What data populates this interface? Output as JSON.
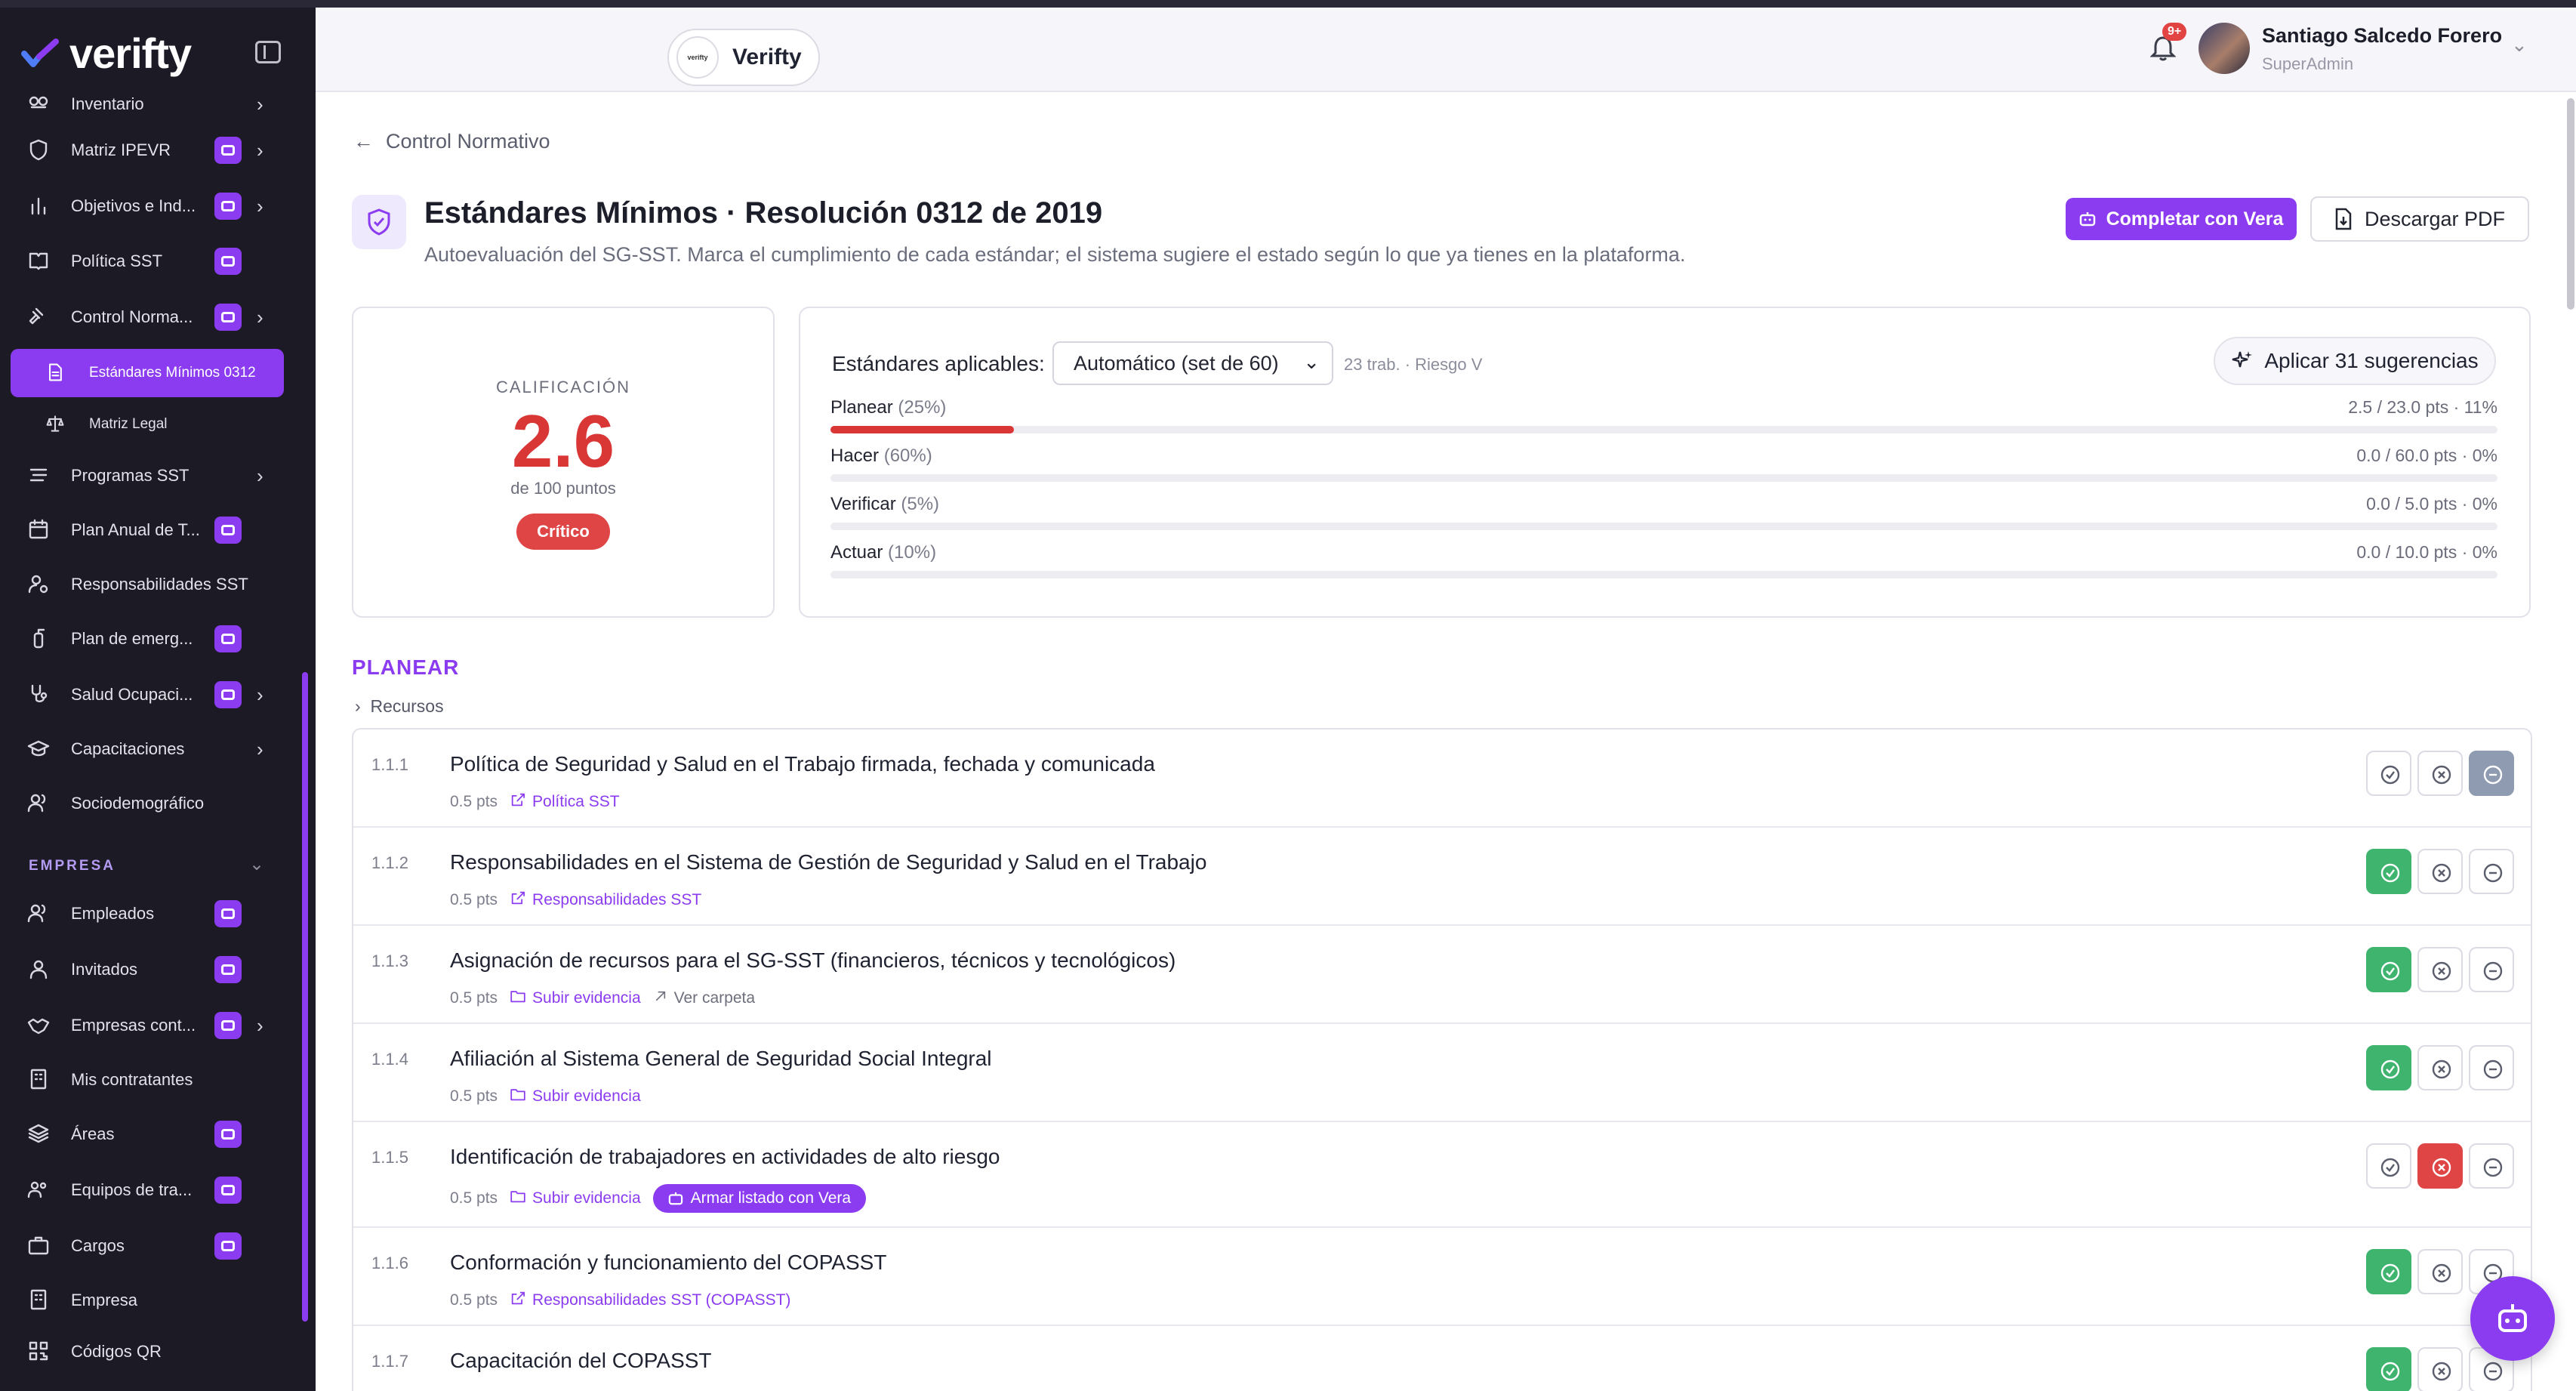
{
  "app": {
    "logo_text": "verifty",
    "brand_color": "#8b3cf0"
  },
  "sidebar": {
    "items": [
      {
        "label": "Inventario",
        "icon": "inventory-icon",
        "bot": false,
        "chevron": true
      },
      {
        "label": "Matriz IPEVR",
        "icon": "shield-icon",
        "bot": true,
        "chevron": true
      },
      {
        "label": "Objetivos e Ind...",
        "icon": "bar-chart-icon",
        "bot": true,
        "chevron": true
      },
      {
        "label": "Política SST",
        "icon": "book-icon",
        "bot": true,
        "chevron": false
      },
      {
        "label": "Control Norma...",
        "icon": "gavel-icon",
        "bot": true,
        "chevron": true
      },
      {
        "label": "Estándares Mínimos 0312",
        "icon": "document-icon",
        "bot": false,
        "chevron": false,
        "active": true,
        "sub": true
      },
      {
        "label": "Matriz Legal",
        "icon": "scale-icon",
        "bot": false,
        "chevron": false,
        "sub": true
      },
      {
        "label": "Programas SST",
        "icon": "list-icon",
        "bot": false,
        "chevron": true
      },
      {
        "label": "Plan Anual de T...",
        "icon": "calendar-icon",
        "bot": true,
        "chevron": false
      },
      {
        "label": "Responsabilidades SST",
        "icon": "user-cog-icon",
        "bot": false,
        "chevron": false
      },
      {
        "label": "Plan de emerg...",
        "icon": "extinguisher-icon",
        "bot": true,
        "chevron": false
      },
      {
        "label": "Salud Ocupaci...",
        "icon": "stethoscope-icon",
        "bot": true,
        "chevron": true
      },
      {
        "label": "Capacitaciones",
        "icon": "graduation-cap-icon",
        "bot": false,
        "chevron": true
      },
      {
        "label": "Sociodemográfico",
        "icon": "users-icon",
        "bot": false,
        "chevron": false
      }
    ],
    "section_label": "EMPRESA",
    "section_items": [
      {
        "label": "Empleados",
        "icon": "users-icon",
        "bot": true,
        "chevron": false
      },
      {
        "label": "Invitados",
        "icon": "user-icon",
        "bot": true,
        "chevron": false
      },
      {
        "label": "Empresas cont...",
        "icon": "handshake-icon",
        "bot": true,
        "chevron": true
      },
      {
        "label": "Mis contratantes",
        "icon": "building-icon",
        "bot": false,
        "chevron": false
      },
      {
        "label": "Áreas",
        "icon": "layers-icon",
        "bot": true,
        "chevron": false
      },
      {
        "label": "Equipos de tra...",
        "icon": "team-icon",
        "bot": true,
        "chevron": false
      },
      {
        "label": "Cargos",
        "icon": "briefcase-icon",
        "bot": true,
        "chevron": false
      },
      {
        "label": "Empresa",
        "icon": "building-icon",
        "bot": false,
        "chevron": false
      },
      {
        "label": "Códigos QR",
        "icon": "qr-icon",
        "bot": false,
        "chevron": false
      }
    ]
  },
  "header": {
    "org_name": "Verifty",
    "org_logo_text": "verifty",
    "notification_badge": "9+",
    "user_name": "Santiago Salcedo Forero",
    "user_role": "SuperAdmin"
  },
  "page": {
    "back_label": "Control Normativo",
    "title": "Estándares Mínimos · Resolución 0312 de 2019",
    "subtitle": "Autoevaluación del SG-SST. Marca el cumplimiento de cada estándar; el sistema sugiere el estado según lo que ya tienes en la plataforma.",
    "btn_vera": "Completar con Vera",
    "btn_pdf": "Descargar PDF"
  },
  "score": {
    "label": "CALIFICACIÓN",
    "value": "2.6",
    "of_label": "de 100 puntos",
    "status": "Crítico",
    "status_color": "#e04545"
  },
  "standards": {
    "label": "Estándares aplicables:",
    "select_value": "Automático (set de 60)",
    "meta": "23 trab. · Riesgo V",
    "apply_label": "Aplicar 31 sugerencias",
    "phases": [
      {
        "name": "Planear",
        "weight": "(25%)",
        "score": "2.5 / 23.0 pts · 11%",
        "progress": 0.11
      },
      {
        "name": "Hacer",
        "weight": "(60%)",
        "score": "0.0 / 60.0 pts · 0%",
        "progress": 0
      },
      {
        "name": "Verificar",
        "weight": "(5%)",
        "score": "0.0 / 5.0 pts · 0%",
        "progress": 0
      },
      {
        "name": "Actuar",
        "weight": "(10%)",
        "score": "0.0 / 10.0 pts · 0%",
        "progress": 0
      }
    ]
  },
  "group": {
    "title": "PLANEAR",
    "subgroup": "Recursos"
  },
  "rows": [
    {
      "num": "1.1.1",
      "text": "Política de Seguridad y Salud en el Trabajo firmada, fechada y comunicada",
      "pts": "0.5 pts",
      "link": "Política SST",
      "link_icon": "external-link-icon",
      "state": "na"
    },
    {
      "num": "1.1.2",
      "text": "Responsabilidades en el Sistema de Gestión de Seguridad y Salud en el Trabajo",
      "pts": "0.5 pts",
      "link": "Responsabilidades SST",
      "link_icon": "external-link-icon",
      "state": "ok"
    },
    {
      "num": "1.1.3",
      "text": "Asignación de recursos para el SG-SST (financieros, técnicos y tecnológicos)",
      "pts": "0.5 pts",
      "link": "Subir evidencia",
      "link_icon": "folder-icon",
      "extra": "Ver carpeta",
      "state": "ok"
    },
    {
      "num": "1.1.4",
      "text": "Afiliación al Sistema General de Seguridad Social Integral",
      "pts": "0.5 pts",
      "link": "Subir evidencia",
      "link_icon": "folder-icon",
      "state": "ok"
    },
    {
      "num": "1.1.5",
      "text": "Identificación de trabajadores en actividades de alto riesgo",
      "pts": "0.5 pts",
      "link": "Subir evidencia",
      "link_icon": "folder-icon",
      "pill": "Armar listado con Vera",
      "state": "no"
    },
    {
      "num": "1.1.6",
      "text": "Conformación y funcionamiento del COPASST",
      "pts": "0.5 pts",
      "link": "Responsabilidades SST (COPASST)",
      "link_icon": "external-link-icon",
      "state": "ok"
    },
    {
      "num": "1.1.7",
      "text": "Capacitación del COPASST",
      "pts": "",
      "link": "",
      "state": "ok"
    }
  ]
}
